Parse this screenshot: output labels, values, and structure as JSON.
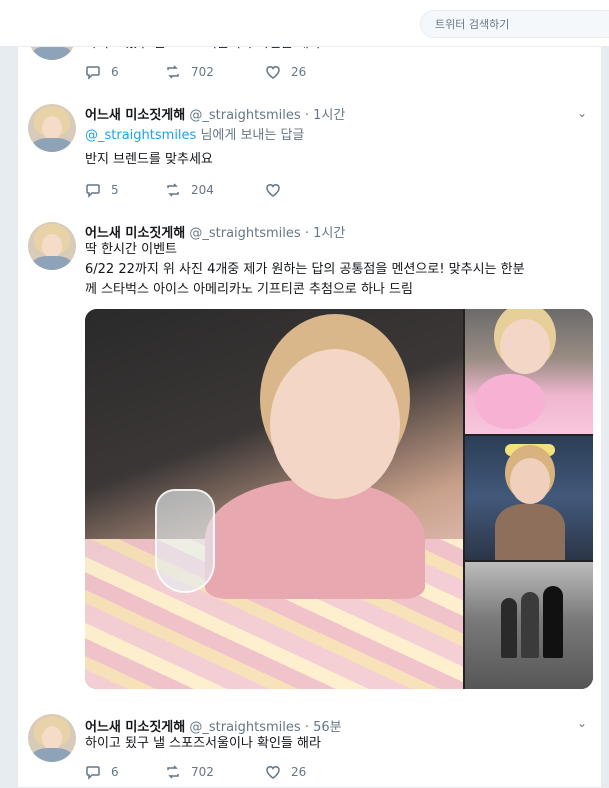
{
  "search": {
    "placeholder": "트위터 검색하기"
  },
  "tweets": [
    {
      "partial_text": "하이고 됬구 낼 스포즈서울이나 확인들 해라",
      "replies": "6",
      "retweets": "702",
      "likes": "26"
    },
    {
      "name": "어느새 미소짓게해",
      "handle": "@_straightsmiles",
      "dot": "·",
      "time": "1시간",
      "reply_to_link": "@_straightsmiles",
      "reply_to_suffix": " 님에게 보내는 답글",
      "text": "반지 브렌드를 맞추세요",
      "replies": "5",
      "retweets": "204",
      "likes": ""
    },
    {
      "name": "어느새 미소짓게해",
      "handle": "@_straightsmiles",
      "dot": "·",
      "time": "1시간",
      "text_line1": "딱 한시간 이벤트",
      "text_line2": "6/22 22까지 위 사진 4개중 제가 원하는 답의 공통점을 멘션으로! 맞추시는 한분",
      "text_line3": "께 스타벅스 아이스 아메리카노 기프티콘 추첨으로 하나 드림"
    },
    {
      "name": "어느새 미소짓게해",
      "handle": "@_straightsmiles",
      "dot": "·",
      "time": "56분",
      "text": "하이고 됬구 낼 스포즈서울이나 확인들 해라",
      "replies": "6",
      "retweets": "702",
      "likes": "26"
    }
  ],
  "icons": {
    "reply": "reply-icon",
    "retweet": "retweet-icon",
    "like": "heart-icon",
    "caret": "chevron-down-icon"
  },
  "colors": {
    "accent": "#1da1f2",
    "muted": "#657786",
    "border": "#e6ecf0"
  }
}
